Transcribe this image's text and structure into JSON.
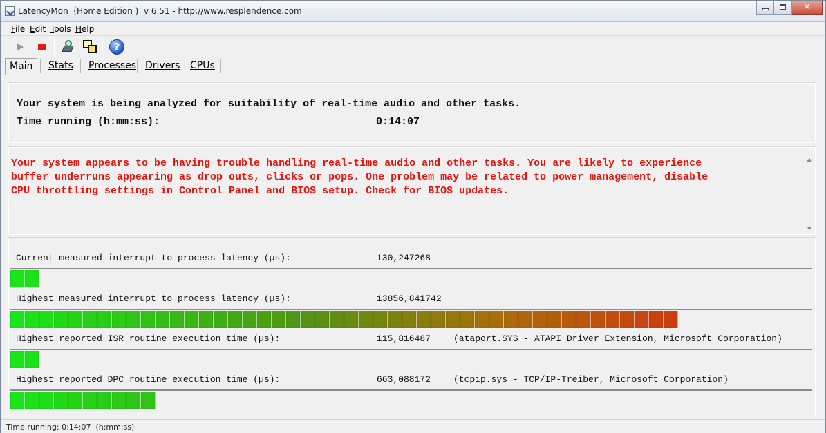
{
  "window": {
    "title": "LatencyMon  (Home Edition )  v 6.51 - http://www.resplendence.com"
  },
  "menu": {
    "items": [
      {
        "mnemonic": "F",
        "rest": "ile"
      },
      {
        "mnemonic": "E",
        "rest": "dit"
      },
      {
        "mnemonic": "T",
        "rest": "ools"
      },
      {
        "mnemonic": "H",
        "rest": "elp"
      }
    ]
  },
  "toolbar": {
    "icons": [
      "play-icon",
      "stop-icon",
      "drivers-icon",
      "windows-icon",
      "help-icon"
    ],
    "help_glyph": "?"
  },
  "tabs": [
    {
      "label": "Main",
      "active": true
    },
    {
      "label": "Stats",
      "active": false
    },
    {
      "label": "Processes",
      "active": false
    },
    {
      "label": "Drivers",
      "active": false
    },
    {
      "label": "CPUs",
      "active": false
    }
  ],
  "status": {
    "analysis_text": "Your system is being analyzed for suitability of real-time audio and other tasks.",
    "time_label": "Time running (h:mm:ss):",
    "time_value": "0:14:07"
  },
  "verdict": {
    "color": "#e8120c",
    "lines": [
      "Your system appears to be having trouble handling real-time audio and other tasks. You are likely to experience",
      "buffer underruns appearing as drop outs, clicks or pops. One problem may be related to power management, disable",
      "CPU throttling settings in Control Panel and BIOS setup. Check for BIOS updates."
    ]
  },
  "metrics": [
    {
      "label": "Current measured interrupt to process latency (µs):",
      "value": "130,247268",
      "source": "",
      "level_fraction": 0.034
    },
    {
      "label": "Highest measured interrupt to process latency (µs):",
      "value": "13856,841742",
      "source": "",
      "level_fraction": 0.83
    },
    {
      "label": "Highest reported ISR routine execution time (µs):",
      "value": "115,816487",
      "source": "(ataport.SYS - ATAPI Driver Extension, Microsoft Corporation)",
      "level_fraction": 0.036
    },
    {
      "label": "Highest reported DPC routine execution time (µs):",
      "value": "663,088172",
      "source": "(tcpip.sys - TCP/IP-Treiber, Microsoft Corporation)",
      "level_fraction": 0.19
    }
  ],
  "statusbar": {
    "text": "Time running: 0:14:07  (h:mm:ss)"
  }
}
